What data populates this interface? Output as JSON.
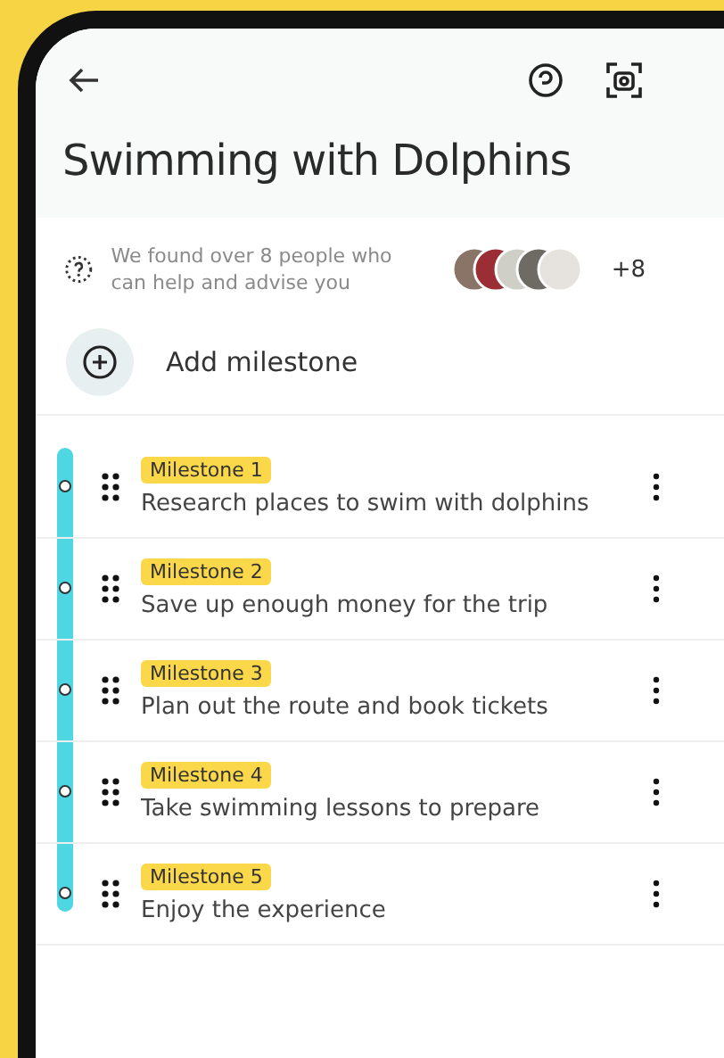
{
  "header": {
    "title": "Swimming with Dolphins"
  },
  "helpers": {
    "text": "We found over 8 people who can help and advise you",
    "more_count": "+8"
  },
  "add_milestone": {
    "label": "Add milestone"
  },
  "milestones": [
    {
      "badge": "Milestone 1",
      "text": "Research places to swim with dolphins"
    },
    {
      "badge": "Milestone 2",
      "text": "Save up enough money for the trip"
    },
    {
      "badge": "Milestone 3",
      "text": "Plan out the route and book tickets"
    },
    {
      "badge": "Milestone 4",
      "text": "Take swimming lessons to prepare"
    },
    {
      "badge": "Milestone 5",
      "text": "Enjoy the experience"
    }
  ]
}
